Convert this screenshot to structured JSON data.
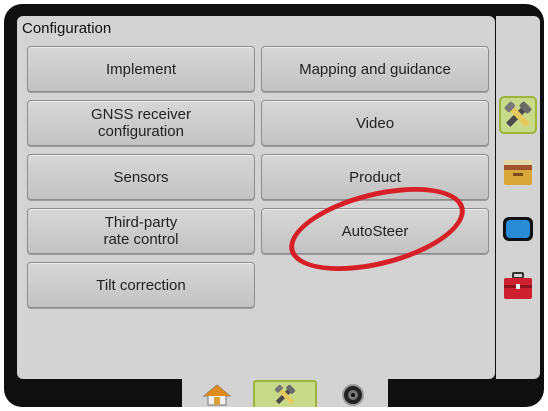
{
  "panel": {
    "title": "Configuration"
  },
  "buttons": {
    "implement": "Implement",
    "mapping": "Mapping and guidance",
    "gnss": "GNSS receiver\nconfiguration",
    "video": "Video",
    "sensors": "Sensors",
    "product": "Product",
    "third_party": "Third-party\nrate control",
    "autosteer": "AutoSteer",
    "tilt": "Tilt correction"
  },
  "sidebar": [
    {
      "icon": "tools-icon",
      "active": true
    },
    {
      "icon": "folder-icon",
      "active": false
    },
    {
      "icon": "display-icon",
      "active": false
    },
    {
      "icon": "toolbox-icon",
      "active": false
    }
  ],
  "bottom_tabs": [
    {
      "icon": "home-icon",
      "active": false
    },
    {
      "icon": "tools-icon",
      "active": true
    },
    {
      "icon": "camera-icon",
      "active": false
    }
  ],
  "colors": {
    "highlight": "#d61f26",
    "active_tab": "#c9d98a",
    "panel": "#d3d3d3",
    "frame": "#0f0f0f"
  }
}
